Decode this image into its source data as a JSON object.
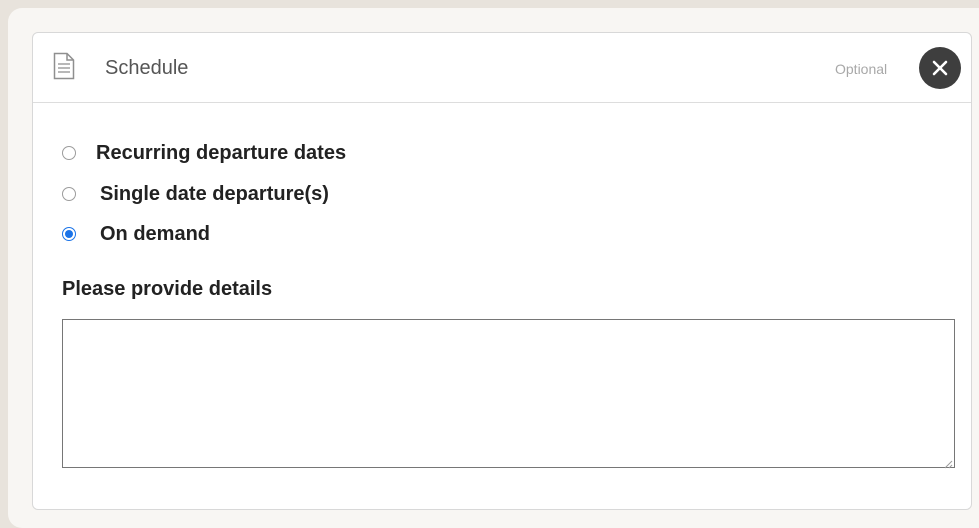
{
  "card": {
    "title": "Schedule",
    "optional_label": "Optional",
    "header_icon": "document-icon",
    "close_icon": "close-icon"
  },
  "schedule_options": [
    {
      "label": "Recurring departure dates",
      "selected": false
    },
    {
      "label": "Single date departure(s)",
      "selected": false
    },
    {
      "label": "On demand",
      "selected": true
    }
  ],
  "details": {
    "label": "Please provide details",
    "value": ""
  },
  "colors": {
    "accent": "#1a73e8",
    "close_button": "#3e3e3e",
    "background": "#e8e3dc"
  }
}
